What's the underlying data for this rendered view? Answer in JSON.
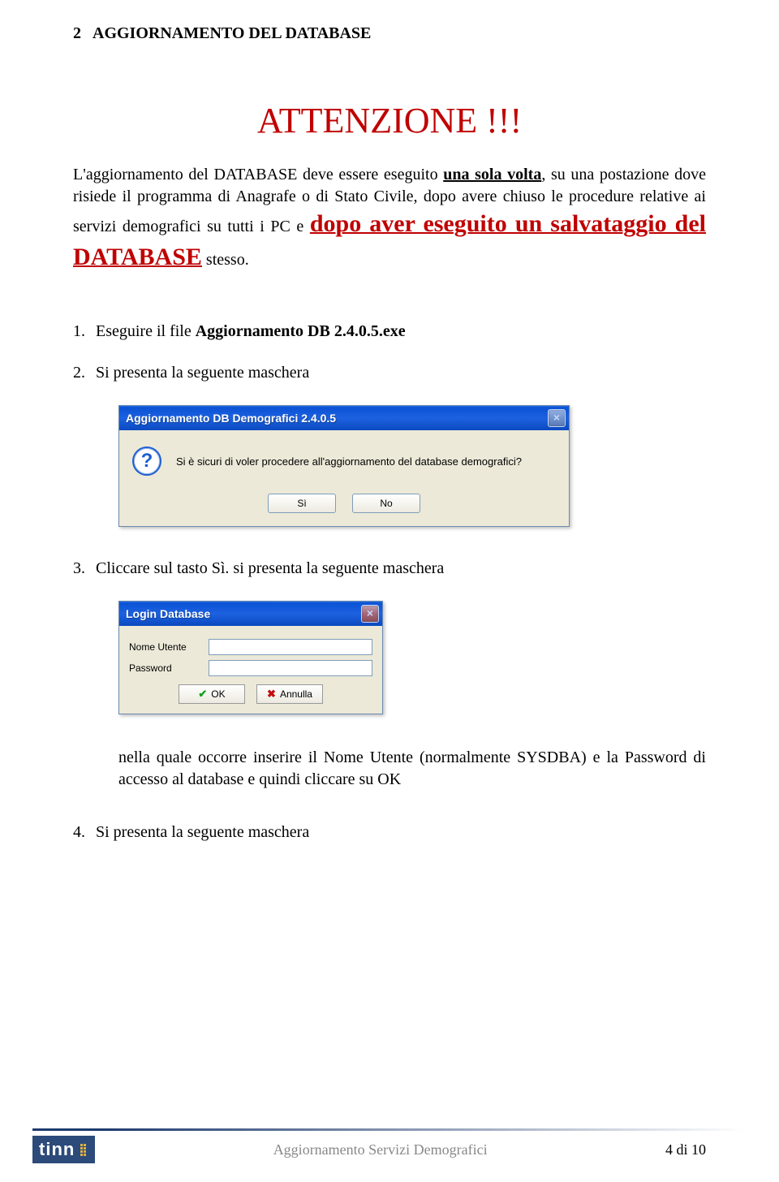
{
  "section": {
    "number": "2",
    "title": "AGGIORNAMENTO DEL DATABASE"
  },
  "attention": "ATTENZIONE !!!",
  "intro": {
    "p1_a": "L'aggiornamento del DATABASE deve essere eseguito ",
    "p1_b": "una sola volta",
    "p1_c": ", su una postazione dove risiede il programma di Anagrafe o di Stato Civile, dopo avere chiuso le procedure relative ai servizi demografici su tutti i PC e ",
    "p1_d": "dopo aver eseguito un salvataggio del DATABASE",
    "p1_e": " stesso."
  },
  "steps": {
    "s1_n": "1.",
    "s1_a": "Eseguire il file ",
    "s1_b": "Aggiornamento DB 2.4.0.5.exe",
    "s2_n": "2.",
    "s2": "Si presenta la seguente maschera",
    "s3_n": "3.",
    "s3": "Cliccare sul tasto Sì. si presenta la seguente maschera",
    "s3_note": "nella quale occorre inserire il Nome Utente (normalmente SYSDBA) e la Password di accesso al database e quindi cliccare su OK",
    "s4_n": "4.",
    "s4": "Si presenta la seguente maschera"
  },
  "dialog_confirm": {
    "title": "Aggiornamento DB Demografici 2.4.0.5",
    "message": "Si è sicuri di voler procedere all'aggiornamento del database demografici?",
    "yes": "Sì",
    "no": "No"
  },
  "dialog_login": {
    "title": "Login Database",
    "user_label": "Nome Utente",
    "pass_label": "Password",
    "ok": "OK",
    "cancel": "Annulla"
  },
  "footer": {
    "logo": "tinn",
    "center": "Aggiornamento Servizi Demografici",
    "page": "4 di 10"
  }
}
